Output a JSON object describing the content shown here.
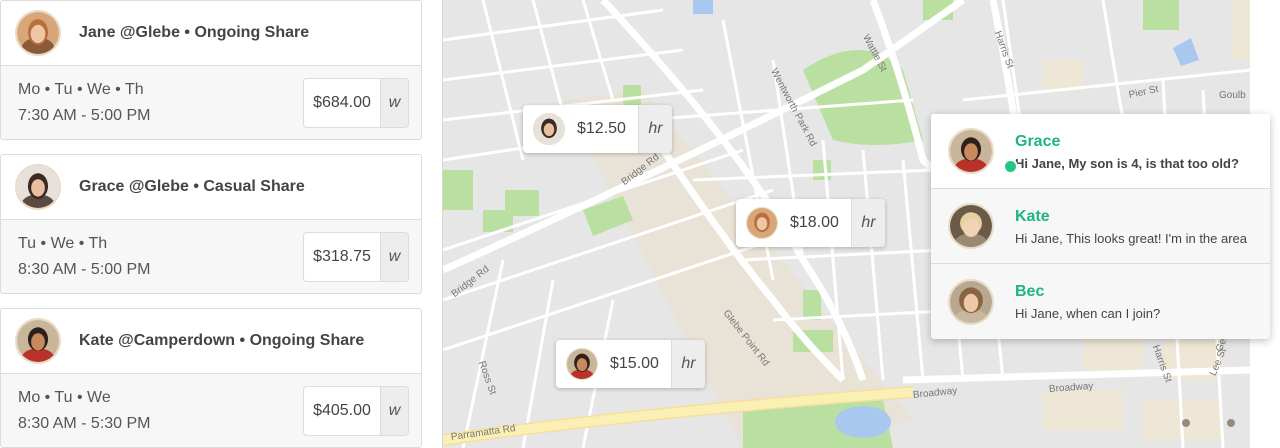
{
  "shares": [
    {
      "title": "Jane @Glebe • Ongoing Share",
      "days": "Mo • Tu • We • Th",
      "time": "7:30 AM - 5:00 PM",
      "price": "$684.00",
      "unit": "w",
      "avatar": "jane-avatar"
    },
    {
      "title": "Grace @Glebe • Casual Share",
      "days": "Tu • We • Th",
      "time": "8:30 AM - 5:00 PM",
      "price": "$318.75",
      "unit": "w",
      "avatar": "grace-avatar"
    },
    {
      "title": "Kate @Camperdown • Ongoing Share",
      "days": "Mo • Tu • We",
      "time": "8:30 AM - 5:30 PM",
      "price": "$405.00",
      "unit": "w",
      "avatar": "kate-avatar"
    }
  ],
  "map": {
    "streets": [
      "Wattle St",
      "Harris St",
      "Wentworth Park Rd",
      "Pier St",
      "Goulb",
      "Bridge Rd",
      "Bridge Rd",
      "Glebe Point Rd",
      "Ross St",
      "Broadway",
      "Broadway",
      "Parramatta Rd",
      "Lee St",
      "Georg",
      "Harris St"
    ],
    "pins": [
      {
        "price": "$12.50",
        "unit": "hr"
      },
      {
        "price": "$18.00",
        "unit": "hr"
      },
      {
        "price": "$15.00",
        "unit": "hr"
      }
    ]
  },
  "messages": [
    {
      "name": "Grace",
      "preview": "Hi Jane, My son is 4, is that too old?",
      "online": true
    },
    {
      "name": "Kate",
      "preview": "Hi Jane, This looks great! I'm in the area",
      "online": false
    },
    {
      "name": "Bec",
      "preview": "Hi Jane, when can I join?",
      "online": false
    }
  ],
  "colors": {
    "accent": "#1fb57f",
    "online": "#1fc882",
    "park": "#b9e0a1",
    "major_road": "#faf0b4",
    "water": "#a9c8ef"
  }
}
